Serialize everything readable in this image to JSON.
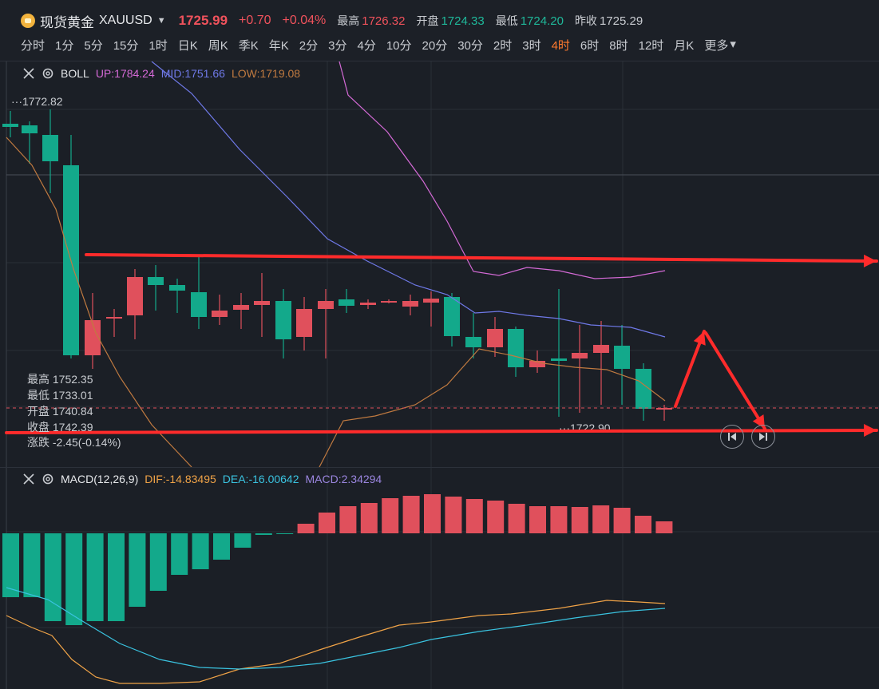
{
  "header": {
    "name": "现货黄金",
    "symbol": "XAUUSD",
    "price": "1725.99",
    "change": "+0.70",
    "change_pct": "+0.04%",
    "high_label": "最高",
    "high": "1726.32",
    "open_label": "开盘",
    "open": "1724.33",
    "low_label": "最低",
    "low": "1724.20",
    "prev_close_label": "昨收",
    "prev_close": "1725.29"
  },
  "periods": [
    {
      "label": "分时"
    },
    {
      "label": "1分"
    },
    {
      "label": "5分"
    },
    {
      "label": "15分"
    },
    {
      "label": "1时"
    },
    {
      "label": "日K"
    },
    {
      "label": "周K"
    },
    {
      "label": "季K"
    },
    {
      "label": "年K"
    },
    {
      "label": "2分"
    },
    {
      "label": "3分"
    },
    {
      "label": "4分"
    },
    {
      "label": "10分"
    },
    {
      "label": "20分"
    },
    {
      "label": "30分"
    },
    {
      "label": "2时"
    },
    {
      "label": "3时"
    },
    {
      "label": "4时",
      "active": true
    },
    {
      "label": "6时"
    },
    {
      "label": "8时"
    },
    {
      "label": "12时"
    },
    {
      "label": "月K"
    },
    {
      "label": "更多"
    }
  ],
  "boll": {
    "name": "BOLL",
    "up": "UP:1784.24",
    "mid": "MID:1751.66",
    "low": "LOW:1719.08",
    "colors": {
      "up": "#d46ad6",
      "mid": "#6f79e8",
      "low": "#c07a40"
    }
  },
  "main_chart": {
    "max_label": "1772.82",
    "min_label": "1722.90",
    "ohlc": {
      "high": "最高 1752.35",
      "low": "最低 1733.01",
      "open": "开盘 1740.84",
      "close": "收盘 1742.39",
      "change": "涨跌 -2.45(-0.14%)"
    }
  },
  "macd": {
    "name": "MACD(12,26,9)",
    "dif": "DIF:-14.83495",
    "dea": "DEA:-16.00642",
    "macd": "MACD:2.34294",
    "colors": {
      "dif": "#f0a347",
      "dea": "#3ac3e0",
      "macd": "#9b86e0"
    }
  },
  "colors": {
    "up": "#e0505c",
    "down": "#13a98b",
    "annotation": "#ff2b2b",
    "bg": "#1b1f26"
  }
}
